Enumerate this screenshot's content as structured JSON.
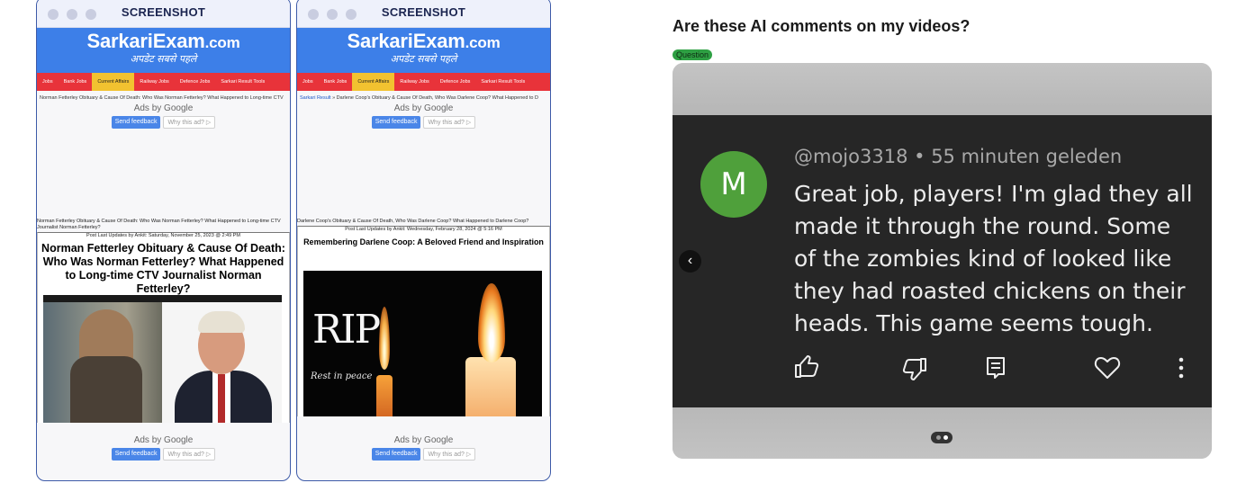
{
  "screenshots": [
    {
      "title": "SCREENSHOT",
      "logo_main": "SarkariExam",
      "logo_suffix": ".com",
      "tagline": "अपडेट सबसे पहले",
      "nav": [
        "Jobs",
        "Bank Jobs",
        "Current Affairs",
        "Railway Jobs",
        "Defence Jobs",
        "Sarkari Result Tools"
      ],
      "nav_active": "Current Affairs",
      "breadcrumb_link": "",
      "breadcrumb_sep": "",
      "breadcrumb_text": "Norman Fetterley Obituary & Cause Of Death: Who Was Norman Fetterley? What Happened to Long-time CTV",
      "ads_label": "Ads by Google",
      "send_feedback": "Send feedback",
      "why_ad": "Why this ad? ▷",
      "post_title_small": "Norman Fetterley Obituary & Cause Of Death: Who Was Norman Fetterley? What Happened to Long-time CTV Journalist Norman Fetterley?",
      "updated": "Post Last Updates by Ankit: Saturday, November 25, 2023 @ 2:49 PM",
      "headline": "Norman Fetterley Obituary & Cause Of Death: Who Was Norman Fetterley? What Happened to Long-time CTV Journalist Norman Fetterley?"
    },
    {
      "title": "SCREENSHOT",
      "logo_main": "SarkariExam",
      "logo_suffix": ".com",
      "tagline": "अपडेट सबसे पहले",
      "nav": [
        "Jobs",
        "Bank Jobs",
        "Current Affairs",
        "Railway Jobs",
        "Defence Jobs",
        "Sarkari Result Tools"
      ],
      "nav_active": "Current Affairs",
      "breadcrumb_link": "Sarkari Result",
      "breadcrumb_sep": "»",
      "breadcrumb_text": "Darlene Coop's Obituary & Cause Of Death, Who Was Darlene Coop? What Happened to D",
      "ads_label": "Ads by Google",
      "send_feedback": "Send feedback",
      "why_ad": "Why this ad? ▷",
      "post_title_small": "Darlene Coop's Obituary & Cause Of Death, Who Was Darlene Coop? What Happened to Darlene Coop?",
      "updated": "Post Last Updates by Ankit: Wednesday, February 28, 2024 @ 5:16 PM",
      "headline": "Remembering Darlene Coop: A Beloved Friend and Inspiration",
      "rip_text": "RIP",
      "rest_text": "Rest in peace"
    }
  ],
  "question": {
    "title": "Are these AI comments on my videos?",
    "badge": "Question",
    "badge_color": "#2ea043"
  },
  "comment": {
    "avatar_letter": "M",
    "avatar_color": "#4fa03b",
    "handle": "@mojo3318",
    "time": "55 minuten geleden",
    "text": "Great job, players! I'm glad they all made it through the round. Some of the zombies kind of looked like they had roasted chickens on their heads. This game seems tough.",
    "actions": [
      "thumbs-up-icon",
      "thumbs-down-icon",
      "reply-icon",
      "heart-icon",
      "more-vert-icon"
    ]
  },
  "carousel": {
    "pages": 2,
    "active": 2
  }
}
